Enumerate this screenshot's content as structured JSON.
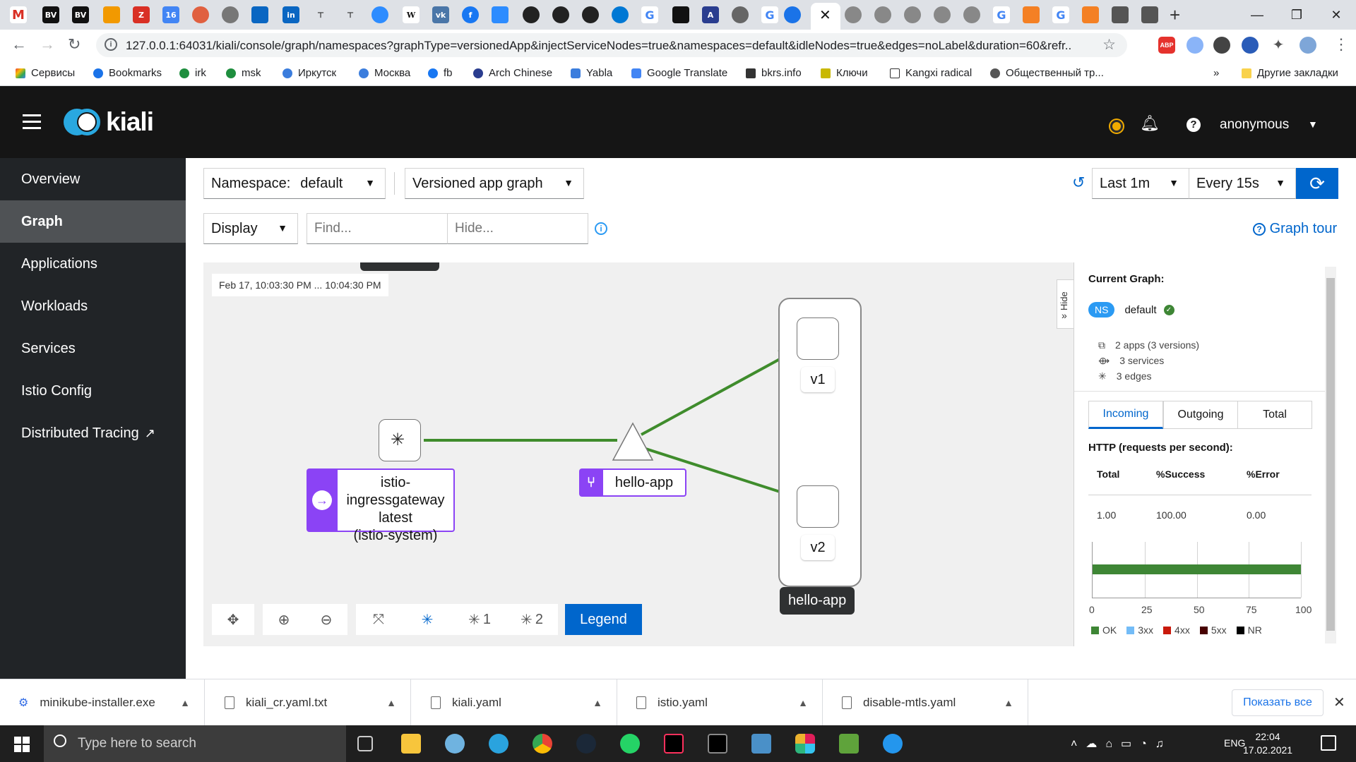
{
  "browser": {
    "url": "127.0.0.1:64031/kiali/console/graph/namespaces?graphType=versionedApp&injectServiceNodes=true&namespaces=default&idleNodes=true&edges=noLabel&duration=60&refr...",
    "bookmarks": [
      "Сервисы",
      "Bookmarks",
      "irk",
      "msk",
      "Иркутск",
      "Москва",
      "fb",
      "Arch Chinese",
      "Yabla",
      "Google Translate",
      "bkrs.info",
      "Ключи",
      "Kangxi radical",
      "Общественный тр...",
      "Другие закладки"
    ]
  },
  "masthead": {
    "logo": "kiali",
    "user": "anonymous"
  },
  "sidebar": {
    "items": [
      {
        "label": "Overview"
      },
      {
        "label": "Graph"
      },
      {
        "label": "Applications"
      },
      {
        "label": "Workloads"
      },
      {
        "label": "Services"
      },
      {
        "label": "Istio Config"
      },
      {
        "label": "Distributed Tracing"
      }
    ]
  },
  "toolbar": {
    "namespace_label": "Namespace:",
    "namespace_value": "default",
    "graph_type": "Versioned app graph",
    "duration": "Last 1m",
    "refresh": "Every 15s",
    "display": "Display",
    "find_placeholder": "Find...",
    "hide_placeholder": "Hide...",
    "graph_tour": "Graph tour"
  },
  "graph": {
    "timestamp": "Feb 17, 10:03:30 PM ... 10:04:30 PM",
    "gateway_label_line1": "istio-ingressgateway",
    "gateway_label_line2": "latest",
    "gateway_label_line3": "(istio-system)",
    "service_label": "hello-app",
    "v1_label": "v1",
    "v2_label": "v2",
    "app_box_label": "hello-app",
    "edge_color": "#3f8c2c",
    "toolbar_layout1": "1",
    "toolbar_layout2": "2",
    "legend_button": "Legend"
  },
  "side_panel": {
    "hide_tab": "Hide",
    "title": "Current Graph:",
    "ns_badge": "NS",
    "namespace": "default",
    "apps_summary": "2 apps (3 versions)",
    "services_summary": "3 services",
    "edges_summary": "3 edges",
    "tabs": [
      "Incoming",
      "Outgoing",
      "Total"
    ],
    "http_title": "HTTP (requests per second):",
    "columns": [
      "Total",
      "%Success",
      "%Error"
    ],
    "row": [
      "1.00",
      "100.00",
      "0.00"
    ],
    "chart_ticks": [
      "0",
      "25",
      "50",
      "75",
      "100"
    ],
    "ok_percent": 100,
    "legend": [
      {
        "label": "OK",
        "color": "#3e8635"
      },
      {
        "label": "3xx",
        "color": "#73bcf7"
      },
      {
        "label": "4xx",
        "color": "#c9190b"
      },
      {
        "label": "5xx",
        "color": "#470000"
      },
      {
        "label": "NR",
        "color": "#000000"
      }
    ]
  },
  "downloads": {
    "items": [
      "minikube-installer.exe",
      "kiali_cr.yaml.txt",
      "kiali.yaml",
      "istio.yaml",
      "disable-mtls.yaml"
    ],
    "show_all": "Показать все"
  },
  "taskbar": {
    "search_placeholder": "Type here to search",
    "language": "ENG",
    "time": "22:04",
    "date": "17.02.2021"
  }
}
